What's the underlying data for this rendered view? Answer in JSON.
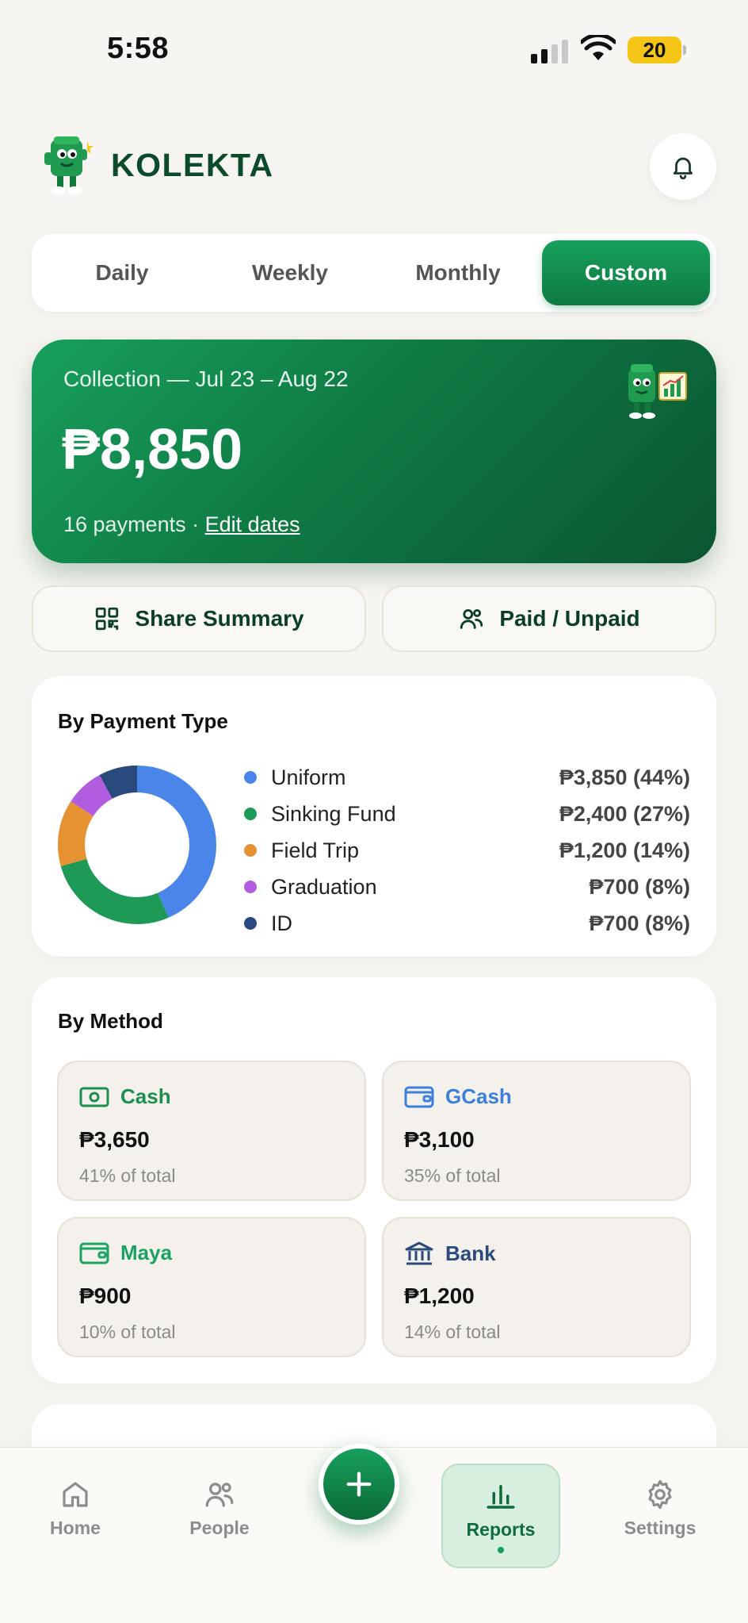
{
  "status": {
    "time": "5:58",
    "battery": "20"
  },
  "header": {
    "brand": "KOLEKTA"
  },
  "tabs": [
    {
      "label": "Daily"
    },
    {
      "label": "Weekly"
    },
    {
      "label": "Monthly"
    },
    {
      "label": "Custom",
      "active": true
    }
  ],
  "hero": {
    "label": "Collection — Jul 23 – Aug 22",
    "amount": "₱8,850",
    "payments": "16 payments · ",
    "edit": "Edit dates"
  },
  "actions": {
    "share": "Share Summary",
    "paid": "Paid / Unpaid"
  },
  "payment_type": {
    "title": "By Payment Type",
    "items": [
      {
        "label": "Uniform",
        "value": "₱3,850 (44%)",
        "color": "#4a86ea",
        "amount": 3850
      },
      {
        "label": "Sinking Fund",
        "value": "₱2,400 (27%)",
        "color": "#1d9a55",
        "amount": 2400
      },
      {
        "label": "Field Trip",
        "value": "₱1,200 (14%)",
        "color": "#e69232",
        "amount": 1200
      },
      {
        "label": "Graduation",
        "value": "₱700 (8%)",
        "color": "#b25ce0",
        "amount": 700
      },
      {
        "label": "ID",
        "value": "₱700 (8%)",
        "color": "#2a4a7d",
        "amount": 700
      }
    ]
  },
  "method": {
    "title": "By Method",
    "items": [
      {
        "label": "Cash",
        "amount": "₱3,650",
        "pct": "41% of total",
        "color": "#1a8f4e",
        "icon": "cash-icon"
      },
      {
        "label": "GCash",
        "amount": "₱3,100",
        "pct": "35% of total",
        "color": "#3b7fdc",
        "icon": "wallet-icon"
      },
      {
        "label": "Maya",
        "amount": "₱900",
        "pct": "10% of total",
        "color": "#1aa360",
        "icon": "wallet-icon"
      },
      {
        "label": "Bank",
        "amount": "₱1,200",
        "pct": "14% of total",
        "color": "#2a4a7d",
        "icon": "bank-icon"
      }
    ]
  },
  "nav": {
    "home": "Home",
    "people": "People",
    "reports": "Reports",
    "settings": "Settings"
  }
}
